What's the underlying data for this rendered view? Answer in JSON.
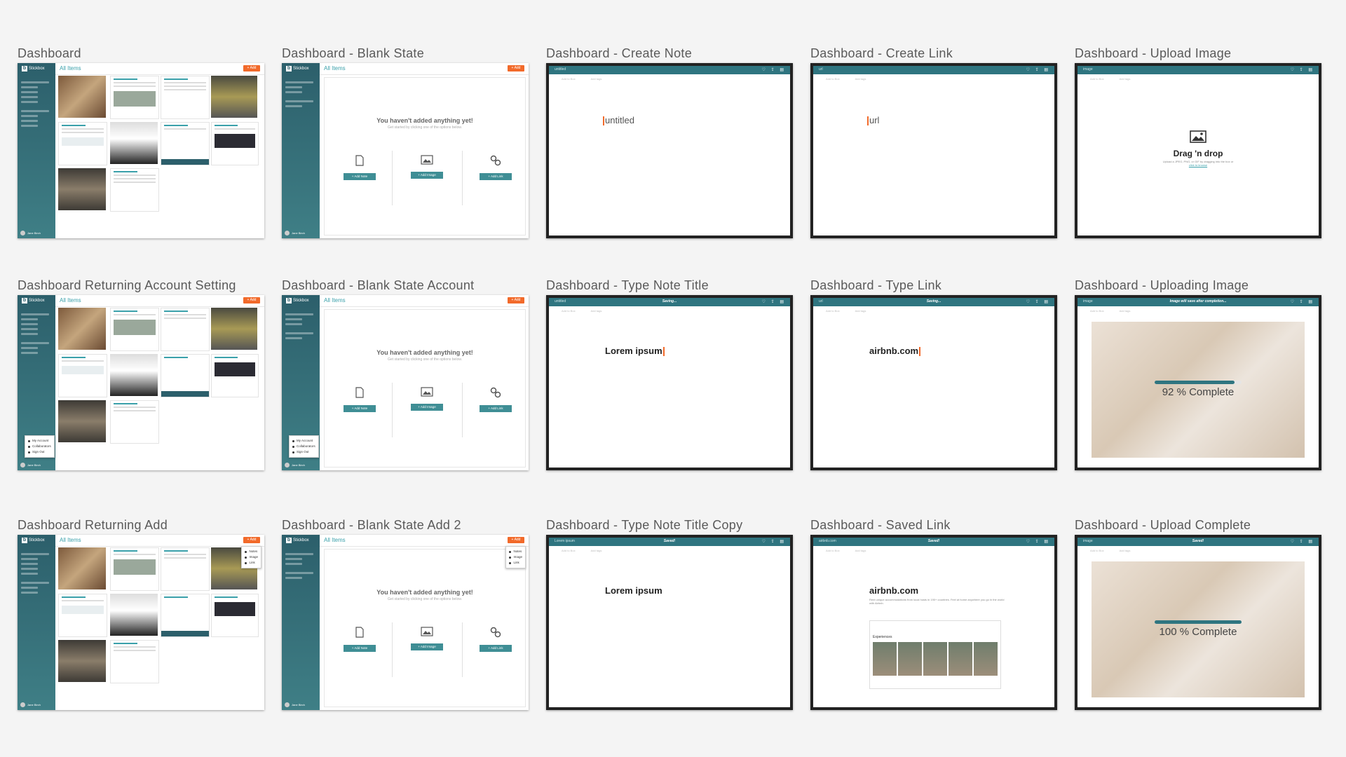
{
  "app": {
    "logo_letter": "b",
    "logo_name": "Stickbox",
    "all_items_label": "All Items",
    "add_label": "+ Add",
    "user_name": "Jane Birch"
  },
  "titles": {
    "r1c1": "Dashboard",
    "r1c2": "Dashboard - Blank State",
    "r1c3": "Dashboard - Create Note",
    "r1c4": "Dashboard - Create Link",
    "r1c5": "Dashboard - Upload Image",
    "r2c1": "Dashboard Returning Account Setting",
    "r2c2": "Dashboard - Blank State Account",
    "r2c3": "Dashboard - Type Note Title",
    "r2c4": "Dashboard - Type Link",
    "r2c5": "Dashboard - Uploading Image",
    "r3c1": "Dashboard Returning Add",
    "r3c2": "Dashboard - Blank State Add 2",
    "r3c3": "Dashboard - Type Note Title Copy",
    "r3c4": "Dashboard - Saved Link",
    "r3c5": "Dashboard - Upload Complete"
  },
  "blank_state": {
    "title": "You haven't added anything yet!",
    "subtitle": "Get started by clicking one of the options below.",
    "add_note": "+ Add Note",
    "add_image": "+ Add Image",
    "add_link": "+ Add Link"
  },
  "account_menu": [
    "My Account",
    "Collaborators",
    "Sign Out"
  ],
  "add_menu": [
    "Notes",
    "Image",
    "Link"
  ],
  "editor": {
    "add_to_box": "Add to Box",
    "add_tags": "Add tags",
    "untitled": "untitled",
    "url": "url",
    "image": "image",
    "note_placeholder": "untitled",
    "link_placeholder": "url",
    "saving": "Saving...",
    "saved": "Saved!",
    "note_title": "Lorem ipsum",
    "link_title": "airbnb.com",
    "image_pending": "Image will save after completion...",
    "link_desc": "Rent unique accommodations from local hosts in 190+ countries. Feel at home anywhere you go in the world with Airbnb.",
    "experiences_label": "Experiences"
  },
  "upload": {
    "drag_title": "Drag 'n drop",
    "drag_sub": "Upload a JPEG, PNG, or GIF by dragging into the box or",
    "drag_link": "click to browse",
    "progress_1": "92 % Complete",
    "progress_1_value": 0.92,
    "progress_2": "100 % Complete",
    "progress_2_value": 1.0
  },
  "colors": {
    "teal": "#2f7580",
    "accent": "#f26a2a",
    "link": "#3aa0aa"
  }
}
